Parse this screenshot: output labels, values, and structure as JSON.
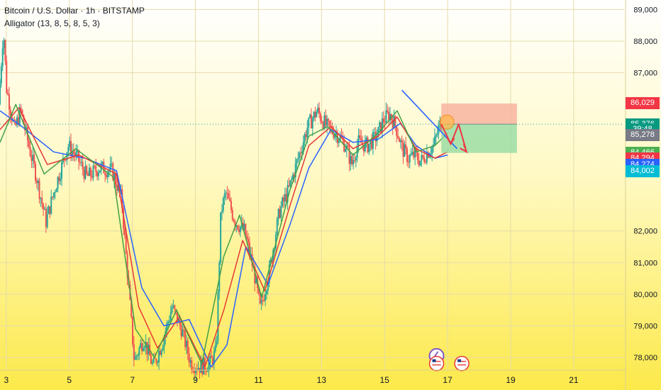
{
  "header": {
    "title": "Bitcoin / U.S. Dollar · 1h · BITSTAMP",
    "indicator": "Alligator (13, 8, 5, 8, 5, 3)"
  },
  "colors": {
    "bg_top": "#ffffff",
    "bg_bottom": "#fce94a",
    "candle_up": "#26a69a",
    "candle_down": "#ef5350",
    "jaw": "#2962ff",
    "teeth": "#e53935",
    "lips": "#43a047",
    "trendline": "#2962ff",
    "arrow": "#f23645",
    "target_zone": "#8fd9a0",
    "stop_zone": "#f8b4a0"
  },
  "chart_data": {
    "type": "candlestick",
    "symbol": "Bitcoin / U.S. Dollar",
    "timeframe": "1h",
    "exchange": "BITSTAMP",
    "x_ticks": [
      "3",
      "5",
      "7",
      "9",
      "11",
      "13",
      "15",
      "17",
      "19",
      "21"
    ],
    "x_tick_days": [
      3,
      5,
      7,
      9,
      11,
      13,
      15,
      17,
      19,
      21
    ],
    "xlim": [
      2.8,
      22.6
    ],
    "y_ticks": [
      "89,000",
      "88,000",
      "87,000",
      "82,000",
      "81,000",
      "80,000",
      "79,000",
      "78,000"
    ],
    "y_tick_values": [
      89000,
      88000,
      87000,
      82000,
      81000,
      80000,
      79000,
      78000
    ],
    "ylim": [
      77600,
      89300
    ],
    "price_path": [
      [
        2.8,
        86000
      ],
      [
        2.95,
        88400
      ],
      [
        3.05,
        86500
      ],
      [
        3.3,
        85200
      ],
      [
        3.5,
        85800
      ],
      [
        3.8,
        84500
      ],
      [
        4.0,
        83700
      ],
      [
        4.3,
        82300
      ],
      [
        4.6,
        83400
      ],
      [
        5.0,
        84700
      ],
      [
        5.3,
        84300
      ],
      [
        5.6,
        83700
      ],
      [
        6.0,
        84000
      ],
      [
        6.4,
        83900
      ],
      [
        6.7,
        83000
      ],
      [
        6.9,
        80500
      ],
      [
        7.1,
        77900
      ],
      [
        7.4,
        78600
      ],
      [
        7.7,
        77700
      ],
      [
        8.0,
        78500
      ],
      [
        8.3,
        79600
      ],
      [
        8.6,
        78900
      ],
      [
        8.9,
        77800
      ],
      [
        9.2,
        77700
      ],
      [
        9.5,
        77800
      ],
      [
        9.7,
        78200
      ],
      [
        9.85,
        82600
      ],
      [
        10.0,
        83200
      ],
      [
        10.3,
        82300
      ],
      [
        10.6,
        82000
      ],
      [
        10.9,
        80700
      ],
      [
        11.1,
        79500
      ],
      [
        11.4,
        80800
      ],
      [
        11.7,
        82600
      ],
      [
        12.0,
        83300
      ],
      [
        12.3,
        84300
      ],
      [
        12.6,
        85300
      ],
      [
        12.9,
        85800
      ],
      [
        13.2,
        85300
      ],
      [
        13.5,
        85100
      ],
      [
        13.8,
        84700
      ],
      [
        14.0,
        84100
      ],
      [
        14.2,
        84800
      ],
      [
        14.5,
        84700
      ],
      [
        14.8,
        85000
      ],
      [
        15.0,
        85500
      ],
      [
        15.2,
        85700
      ],
      [
        15.4,
        85300
      ],
      [
        15.6,
        84600
      ],
      [
        15.8,
        84300
      ],
      [
        16.0,
        84400
      ],
      [
        16.2,
        84200
      ],
      [
        16.4,
        84500
      ],
      [
        16.6,
        84700
      ],
      [
        16.8,
        85376
      ]
    ],
    "alligator": {
      "jaw": [
        [
          2.8,
          85800
        ],
        [
          3.5,
          85300
        ],
        [
          4.5,
          84500
        ],
        [
          5.5,
          84300
        ],
        [
          6.5,
          83900
        ],
        [
          7.3,
          80200
        ],
        [
          8.0,
          79000
        ],
        [
          8.8,
          79200
        ],
        [
          9.5,
          77700
        ],
        [
          10.0,
          78400
        ],
        [
          10.6,
          81500
        ],
        [
          11.3,
          80300
        ],
        [
          12.0,
          82200
        ],
        [
          12.6,
          84000
        ],
        [
          13.3,
          85200
        ],
        [
          14.0,
          84800
        ],
        [
          14.8,
          84900
        ],
        [
          15.5,
          85400
        ],
        [
          16.0,
          84700
        ],
        [
          16.6,
          84300
        ],
        [
          17.0,
          84400
        ]
      ],
      "teeth": [
        [
          2.8,
          85200
        ],
        [
          3.4,
          85900
        ],
        [
          4.3,
          84100
        ],
        [
          5.3,
          84400
        ],
        [
          6.5,
          83800
        ],
        [
          7.2,
          79600
        ],
        [
          7.8,
          78300
        ],
        [
          8.5,
          79300
        ],
        [
          9.3,
          77700
        ],
        [
          9.9,
          79500
        ],
        [
          10.5,
          81700
        ],
        [
          11.2,
          80100
        ],
        [
          12.0,
          82800
        ],
        [
          12.6,
          84700
        ],
        [
          13.3,
          85300
        ],
        [
          14.0,
          84600
        ],
        [
          14.8,
          85000
        ],
        [
          15.4,
          85600
        ],
        [
          16.0,
          84600
        ],
        [
          16.6,
          84300
        ],
        [
          17.0,
          84500
        ]
      ],
      "lips": [
        [
          2.8,
          84800
        ],
        [
          3.3,
          86000
        ],
        [
          4.2,
          83800
        ],
        [
          5.2,
          84600
        ],
        [
          6.4,
          83700
        ],
        [
          7.1,
          78900
        ],
        [
          7.7,
          78000
        ],
        [
          8.4,
          79500
        ],
        [
          9.2,
          77800
        ],
        [
          9.9,
          81200
        ],
        [
          10.4,
          82500
        ],
        [
          11.1,
          79900
        ],
        [
          12.0,
          83300
        ],
        [
          12.6,
          85000
        ],
        [
          13.2,
          85300
        ],
        [
          14.0,
          84400
        ],
        [
          14.8,
          85100
        ],
        [
          15.4,
          85800
        ],
        [
          16.0,
          84500
        ],
        [
          16.6,
          84700
        ],
        [
          17.0,
          85100
        ]
      ]
    },
    "price_labels": [
      {
        "text": "86,029",
        "value": 86029,
        "color": "#f23645"
      },
      {
        "text": "85,376",
        "value": 85376,
        "color": "#089981"
      },
      {
        "text": "39:48",
        "value": 85200,
        "color": "#089981"
      },
      {
        "text": "85,278",
        "value": 85030,
        "color": "#787b86"
      },
      {
        "text": "84,466",
        "value": 84466,
        "color": "#4caf50"
      },
      {
        "text": "84,294",
        "value": 84294,
        "color": "#f23645"
      },
      {
        "text": "84,274",
        "value": 84100,
        "color": "#2962ff"
      },
      {
        "text": "84,002",
        "value": 83890,
        "color": "#00bcd4"
      }
    ],
    "last_price": 85376,
    "position": {
      "entry": 85376,
      "stop": 86029,
      "target": 84466,
      "x_start": 16.8,
      "x_end": 19.2
    },
    "trendline": [
      [
        15.55,
        86450
      ],
      [
        17.3,
        84600
      ]
    ],
    "projection_path": [
      [
        16.8,
        85376
      ],
      [
        17.1,
        84750
      ],
      [
        17.35,
        85376
      ],
      [
        17.6,
        84500
      ]
    ],
    "event_markers": [
      {
        "x": 16.65,
        "y": 78050,
        "icon": "lightning-icon"
      },
      {
        "x": 16.65,
        "y": 77810,
        "icon": "us-flag-icon"
      },
      {
        "x": 17.45,
        "y": 77810,
        "icon": "us-flag-icon"
      }
    ]
  }
}
